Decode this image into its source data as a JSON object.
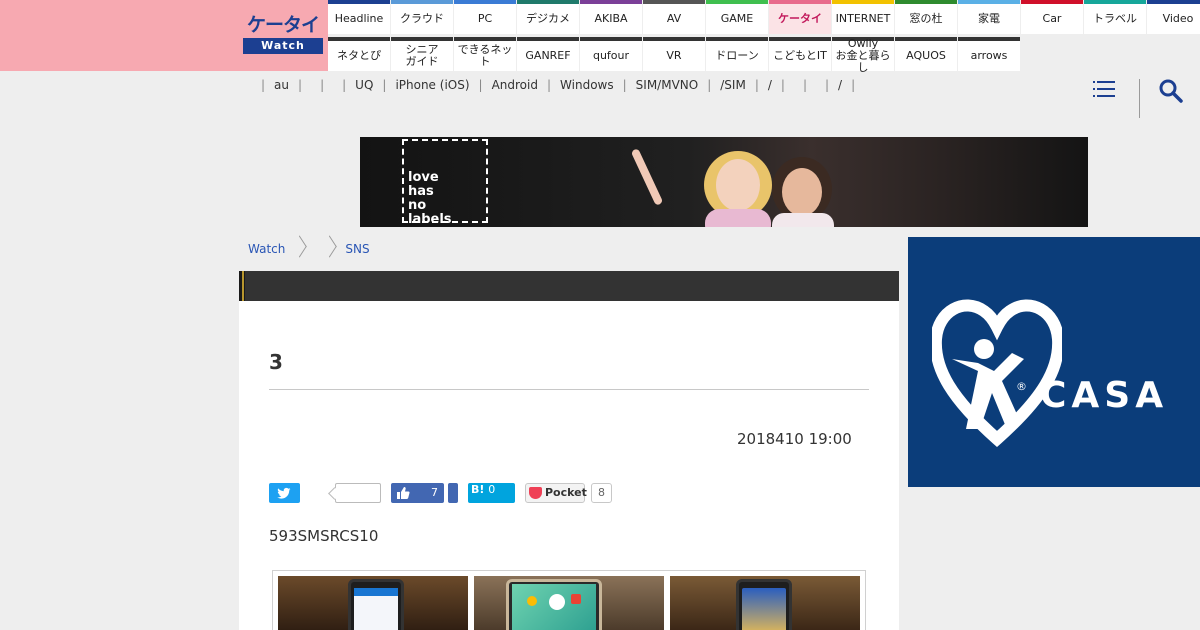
{
  "logo": {
    "top_text": "ケータイ",
    "bottom_text": "Watch"
  },
  "nav": {
    "row1": [
      {
        "label": "Headline",
        "color": "#1c3f91"
      },
      {
        "label": "クラウド",
        "color": "#5a9ad8"
      },
      {
        "label": "PC",
        "color": "#3a7bd5"
      },
      {
        "label": "デジカメ",
        "color": "#1f7a6b"
      },
      {
        "label": "AKIBA",
        "color": "#7b3f98"
      },
      {
        "label": "AV",
        "color": "#555555"
      },
      {
        "label": "GAME",
        "color": "#3fbf4f"
      },
      {
        "label": "ケータイ",
        "color": "#e86a8c"
      },
      {
        "label": "INTERNET",
        "color": "#f2c200"
      },
      {
        "label": "窓の杜",
        "color": "#2e8b2e"
      },
      {
        "label": "家電",
        "color": "#5ab0e6"
      },
      {
        "label": "Car",
        "color": "#d0102a"
      },
      {
        "label": "トラベル",
        "color": "#16a79a"
      },
      {
        "label": "Video",
        "color": "#1c3f91"
      }
    ],
    "row2": [
      {
        "label": "ネタとぴ"
      },
      {
        "label": "シニア\nガイド"
      },
      {
        "label": "できるネット"
      },
      {
        "label": "GANREF"
      },
      {
        "label": "qufour"
      },
      {
        "label": "VR"
      },
      {
        "label": "ドローン"
      },
      {
        "label": "こどもとIT"
      },
      {
        "label": "Owlly\nお金と暮らし"
      },
      {
        "label": "AQUOS"
      },
      {
        "label": "arrows"
      }
    ],
    "active": "ケータイ"
  },
  "subnav": {
    "items": [
      "",
      "au",
      "",
      "",
      "UQ",
      "iPhone (iOS)",
      "Android",
      "Windows",
      "SIM/MVNO",
      "/SIM",
      "/",
      "",
      "",
      "/",
      ""
    ]
  },
  "banner": {
    "text": "love\nhas\nno\nlabels"
  },
  "breadcrumb": [
    "Watch",
    "",
    "SNS"
  ],
  "article": {
    "category_text": "",
    "title": "3",
    "date": "2018410 19:00",
    "lead": "593SMSRCS10"
  },
  "share": {
    "facebook_count": "7",
    "hatena_label": "B!",
    "hatena_count": "0",
    "pocket_label": "Pocket",
    "pocket_count": "8"
  },
  "sidead": {
    "brand": "CASA",
    "reg": "®"
  }
}
